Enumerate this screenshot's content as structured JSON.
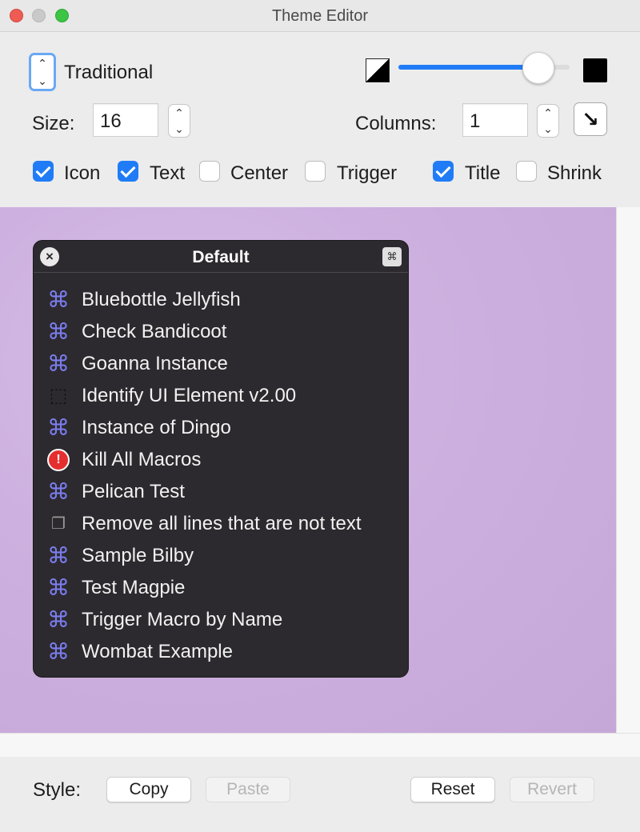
{
  "window": {
    "title": "Theme Editor"
  },
  "controls": {
    "theme_name": "Traditional",
    "size_label": "Size:",
    "size_value": "16",
    "columns_label": "Columns:",
    "columns_value": "1",
    "opacity_level_percent": 82,
    "direction_glyph": "↘",
    "checkboxes": [
      {
        "label": "Icon",
        "checked": true
      },
      {
        "label": "Text",
        "checked": true
      },
      {
        "label": "Center",
        "checked": false
      },
      {
        "label": "Trigger",
        "checked": false
      },
      {
        "label": "Title",
        "checked": true
      },
      {
        "label": "Shrink",
        "checked": false
      }
    ]
  },
  "palette": {
    "title": "Default",
    "close_glyph": "×",
    "gear_glyph": "⌘",
    "items": [
      {
        "label": "Bluebottle Jellyfish",
        "icon": "command-icon"
      },
      {
        "label": "Check Bandicoot",
        "icon": "command-icon"
      },
      {
        "label": "Goanna Instance",
        "icon": "command-icon"
      },
      {
        "label": "Identify UI Element v2.00",
        "icon": "cube-icon"
      },
      {
        "label": "Instance of Dingo",
        "icon": "command-icon"
      },
      {
        "label": "Kill All Macros",
        "icon": "stop-icon"
      },
      {
        "label": "Pelican Test",
        "icon": "command-icon"
      },
      {
        "label": "Remove all lines that are not text",
        "icon": "windows-icon"
      },
      {
        "label": "Sample Bilby",
        "icon": "command-icon"
      },
      {
        "label": "Test Magpie",
        "icon": "command-icon"
      },
      {
        "label": "Trigger Macro by Name",
        "icon": "command-icon"
      },
      {
        "label": "Wombat Example",
        "icon": "command-icon"
      }
    ]
  },
  "bottom": {
    "style_label": "Style:",
    "copy_label": "Copy",
    "paste_label": "Paste",
    "reset_label": "Reset",
    "revert_label": "Revert"
  },
  "colors": {
    "accent": "#1f7cf6",
    "palette_bg": "#2c2a2e",
    "command_icon": "#7b7df0",
    "preview_bg": "#cdb0df"
  }
}
